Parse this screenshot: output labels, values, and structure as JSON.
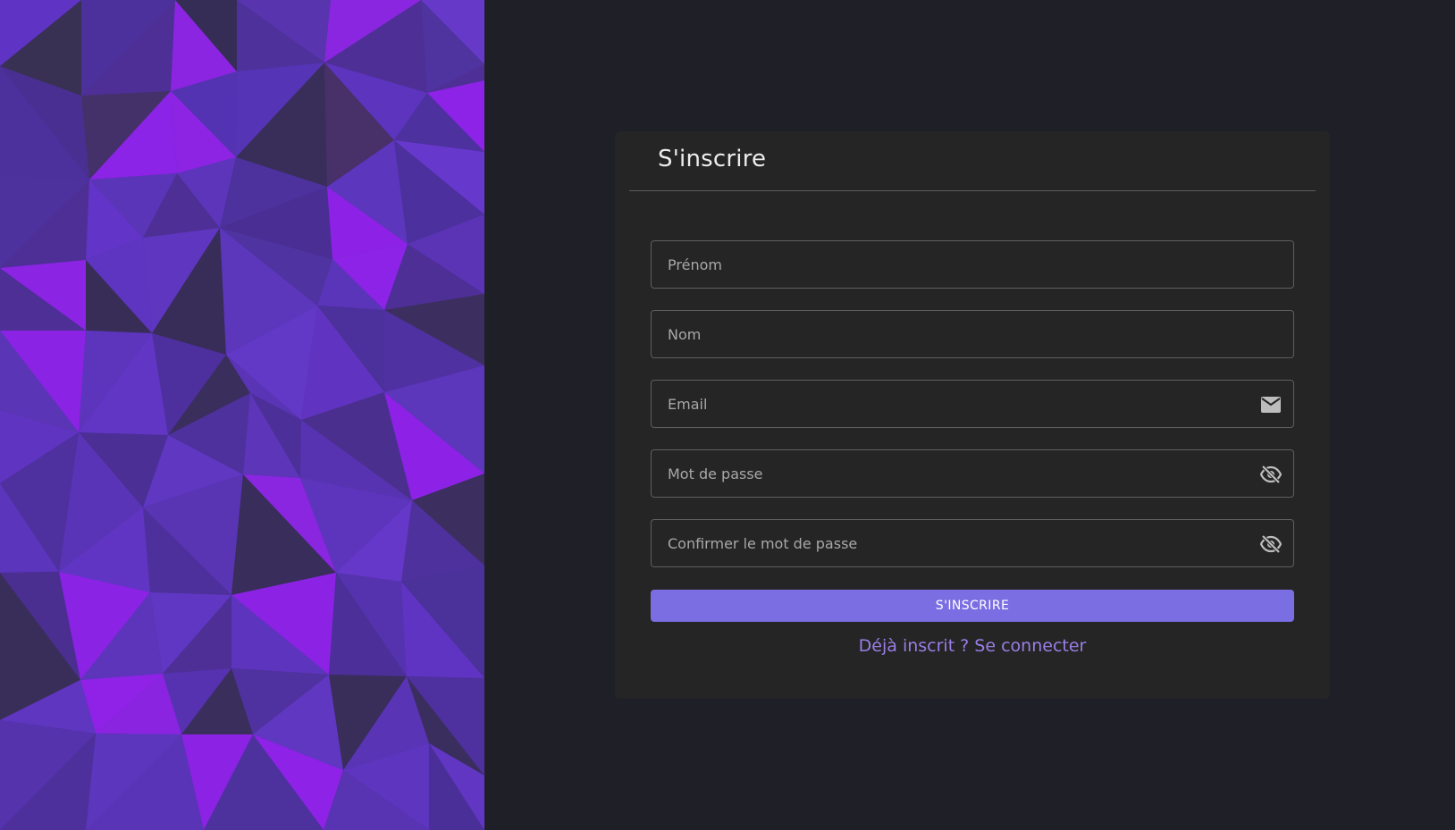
{
  "form": {
    "title": "S'inscrire",
    "fields": [
      {
        "name": "first-name",
        "placeholder": "Prénom",
        "value": ""
      },
      {
        "name": "last-name",
        "placeholder": "Nom",
        "value": ""
      },
      {
        "name": "email",
        "placeholder": "Email",
        "value": "",
        "icon": "mail-icon"
      },
      {
        "name": "password",
        "placeholder": "Mot de passe",
        "value": "",
        "icon": "eye-off-icon"
      },
      {
        "name": "confirm-password",
        "placeholder": "Confirmer le mot de passe",
        "value": "",
        "icon": "eye-off-icon"
      }
    ],
    "submit_label": "S'INSCRIRE",
    "login_link": "Déjà inscrit ? Se connecter"
  },
  "colors": {
    "background": "#1f2027",
    "card": "#252525",
    "accent": "#7a6ee2",
    "link": "#9a7ee6",
    "decor_dark": "#362b57",
    "decor_mid": "#4d2f96",
    "decor_medium": "#5a34b5",
    "decor_bright": "#8a20e6"
  }
}
